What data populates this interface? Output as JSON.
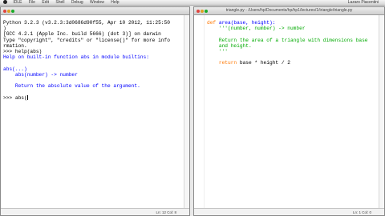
{
  "menubar": {
    "items": [
      "IDLE",
      "File",
      "Edit",
      "Shell",
      "Debug",
      "Window",
      "Help"
    ],
    "right": "Lazaro Piacentini"
  },
  "shell": {
    "line1": "Python 3.2.3 (v3.2.3:3d0686d90f55, Apr 10 2012, 11:25:50",
    "line2": ")",
    "line3": "[GCC 4.2.1 (Apple Inc. build 5666) (dot 3)] on darwin",
    "line4": "Type \"copyright\", \"credits\" or \"license()\" for more info",
    "line5": "rmation.",
    "line6": ">>> help(abs)",
    "line7": "Help on built-in function abs in module builtins:",
    "line8": "",
    "line9": "abs(...)",
    "line10": "    abs(number) -> number",
    "line11": "",
    "line12": "    Return the absolute value of the argument.",
    "line13": "",
    "prompt": ">>> ",
    "input": "abs(",
    "status": "Ln: 12 Col: 8"
  },
  "editor": {
    "title": "triangle.py - /Users/hp/Documents/hp/hp1/lectures/1/triangle/triangle.py",
    "def_kw": "def",
    "def_sig": " area(base, height):",
    "doc1": "    '''(number, number) -> number",
    "doc2": "",
    "doc3": "    Return the area of a triangle with dimensions base",
    "doc4": "    and height.",
    "doc5": "    '''",
    "blank": "",
    "return_kw": "    return",
    "return_expr": " base * height / 2",
    "status": "Ln: 1 Col: 0"
  }
}
